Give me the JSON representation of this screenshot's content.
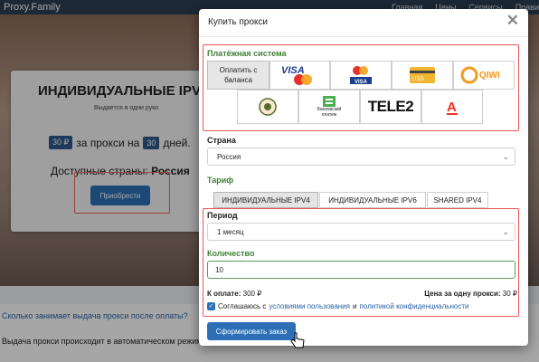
{
  "background": {
    "brand": "Proxy.Family",
    "nav": [
      "Главная",
      "Цены",
      "Сервисы",
      "Прави"
    ],
    "card": {
      "title": "ИНДИВИДУАЛЬНЫЕ IPV4",
      "subtitle": "Выдается в одни руки",
      "qty_chip": "30 ₽",
      "qty_text": "за прокси на",
      "days_chip": "30",
      "days_text": "дней.",
      "countries_label": "Доступные страны:",
      "countries_value": "Россия",
      "buy_label": "Приобрести"
    },
    "faq_question": "Сколько занимает выдача прокси после оплаты?",
    "faq_answer": "Выдача прокси происходит в автоматическом режиме"
  },
  "modal": {
    "title": "Купить прокси",
    "close": "✕",
    "payment": {
      "label": "Платёжная система",
      "methods": [
        {
          "name": "balance",
          "text": "Оплатить с баланса",
          "selected": true
        },
        {
          "name": "visa-mastercard",
          "text": "VISA"
        },
        {
          "name": "mastercard-visa",
          "text": "Mastercard VISA"
        },
        {
          "name": "usd-card",
          "text": "USD"
        },
        {
          "name": "qiwi",
          "text": "QIWI"
        },
        {
          "name": "sberbank",
          "text": ""
        },
        {
          "name": "bank-transfer",
          "text": "Банковский платеж"
        },
        {
          "name": "tele2",
          "text": "TELE2"
        },
        {
          "name": "alfa",
          "text": "А"
        }
      ]
    },
    "country": {
      "label": "Страна",
      "value": "Россия"
    },
    "tariff": {
      "label": "Тариф",
      "options": [
        "ИНДИВИДУАЛЬНЫЕ IPV4",
        "ИНДИВИДУАЛЬНЫЕ IPV6",
        "SHARED IPV4"
      ],
      "active": 0
    },
    "period": {
      "label": "Период",
      "value": "1 месяц"
    },
    "quantity": {
      "label": "Количество",
      "value": "10"
    },
    "totals": {
      "pay_label": "К оплате:",
      "pay_value": "300 ₽",
      "unit_label": "Цена за одну прокси:",
      "unit_value": "30 ₽"
    },
    "agreement": {
      "prefix": "Соглашаюсь с",
      "terms_link": "условиями пользования",
      "and": "и",
      "privacy_link": "политикой конфиденциальности"
    },
    "submit_label": "Сформировать заказ"
  },
  "colors": {
    "accent_blue": "#2c6fb7",
    "label_green": "#3f7f36",
    "highlight_red": "#e55"
  }
}
